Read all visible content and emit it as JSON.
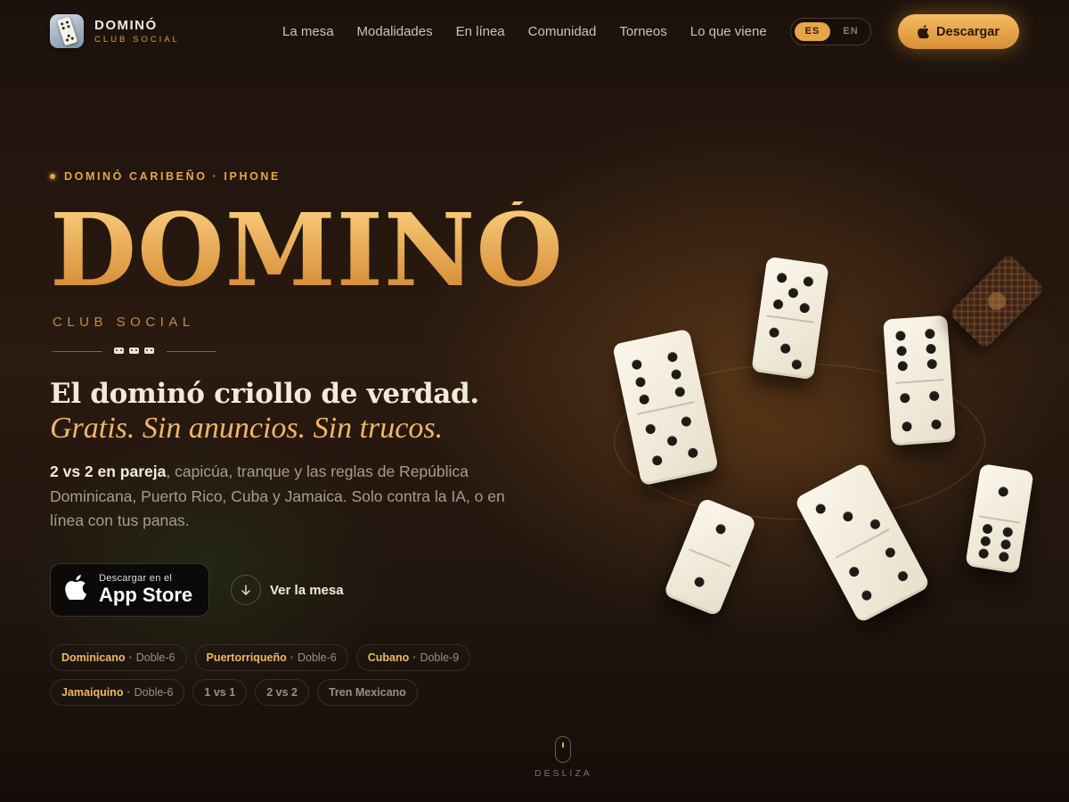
{
  "brand": {
    "name": "DOMINÓ",
    "sub": "CLUB SOCIAL"
  },
  "nav": {
    "links": [
      "La mesa",
      "Modalidades",
      "En línea",
      "Comunidad",
      "Torneos",
      "Lo que viene"
    ],
    "lang": {
      "active": "ES",
      "other": "EN"
    },
    "download_label": "Descargar"
  },
  "hero": {
    "eyebrow": "DOMINÓ CARIBEÑO · IPHONE",
    "title": "DOMINÓ",
    "subtitle": "CLUB SOCIAL",
    "headline": "El dominó criollo de verdad.",
    "tagline": "Gratis. Sin anuncios. Sin trucos.",
    "desc_bold": "2 vs 2 en pareja",
    "desc_rest": ", capicúa, tranque y las reglas de República Dominicana, Puerto Rico, Cuba y Jamaica. Solo contra la IA, o en línea con tus panas.",
    "appstore_small": "Descargar en el",
    "appstore_big": "App Store",
    "ver_label": "Ver la mesa"
  },
  "chips": {
    "row1": [
      {
        "name": "Dominicano",
        "detail": "Doble-6"
      },
      {
        "name": "Puertorriqueño",
        "detail": "Doble-6"
      },
      {
        "name": "Cubano",
        "detail": "Doble-9"
      }
    ],
    "row2": [
      {
        "name": "Jamaiquino",
        "detail": "Doble-6"
      }
    ],
    "plain": [
      "1 vs 1",
      "2 vs 2",
      "Tren Mexicano"
    ]
  },
  "scroll_label": "DESLIZA",
  "colors": {
    "accent": "#e6a648",
    "gold_top": "#f6c877",
    "gold_bottom": "#d88f38",
    "bg": "#1c120c"
  },
  "icons": [
    "apple-icon",
    "arrow-down-icon",
    "mouse-icon",
    "domino-icon"
  ]
}
